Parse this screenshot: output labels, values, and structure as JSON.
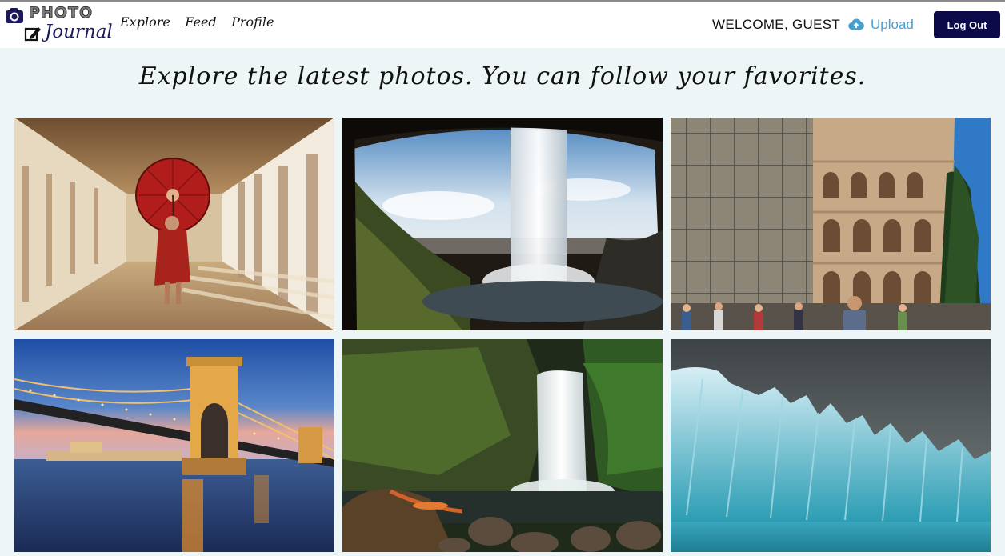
{
  "logo": {
    "line1": "PHOTO",
    "line2": "Journal",
    "icon": "camera-icon",
    "icon2": "edit-icon"
  },
  "nav": [
    {
      "label": "Explore"
    },
    {
      "label": "Feed"
    },
    {
      "label": "Profile"
    }
  ],
  "user": {
    "welcome": "WELCOME, GUEST"
  },
  "actions": {
    "upload_label": "Upload",
    "upload_icon": "cloud-upload-icon",
    "logout_label": "Log Out"
  },
  "colors": {
    "accent": "#4a9fd1",
    "button": "#0d0a4a",
    "page_bg": "#edf5f7"
  },
  "headline": "Explore the latest photos. You can follow your favorites.",
  "photos": [
    {
      "subject": "monk-with-red-umbrella"
    },
    {
      "subject": "waterfall-cave"
    },
    {
      "subject": "colosseum"
    },
    {
      "subject": "chain-bridge-budapest"
    },
    {
      "subject": "forest-waterfall-hammock"
    },
    {
      "subject": "blue-iceberg"
    }
  ]
}
